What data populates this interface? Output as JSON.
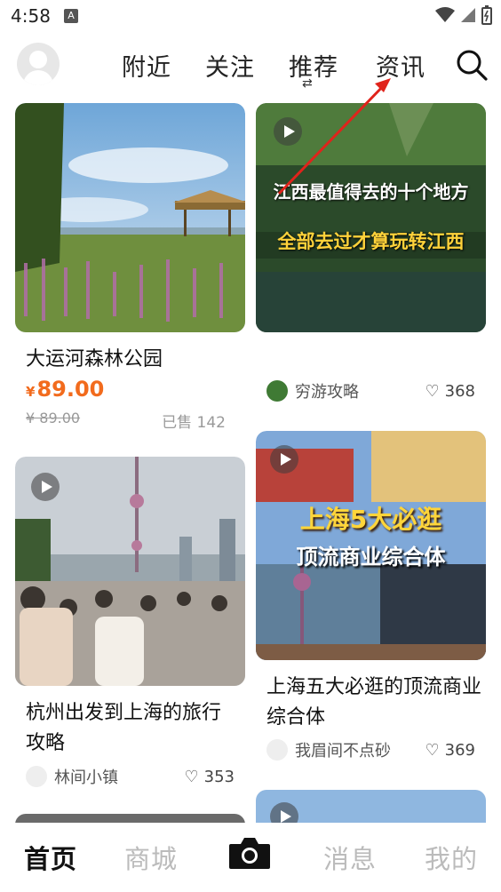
{
  "status": {
    "time": "4:58",
    "notif_letter": "A"
  },
  "topnav": {
    "tabs": [
      "附近",
      "关注",
      "推荐",
      "资讯"
    ],
    "active_index": 2
  },
  "cards": {
    "c1": {
      "title": "大运河森林公园",
      "currency": "¥",
      "price": "89.00",
      "old_price": "¥ 89.00",
      "sold": "已售 142"
    },
    "c2": {
      "overlay1": "江西最值得去的十个地方",
      "overlay2": "全部去过才算玩转江西",
      "author": "穷游攻略",
      "likes": "368"
    },
    "c3": {
      "title": "杭州出发到上海的旅行攻略",
      "author": "林间小镇",
      "likes": "353"
    },
    "c4": {
      "overlay1": "上海5大必逛",
      "overlay2": "顶流商业综合体",
      "title": "上海五大必逛的顶流商业综合体",
      "author": "我眉间不点砂",
      "likes": "369"
    }
  },
  "bottomnav": {
    "home": "首页",
    "mall": "商城",
    "messages": "消息",
    "me": "我的"
  },
  "colors": {
    "accent_price": "#f26b1d",
    "active_tab": "#111111",
    "inactive_tab": "#bbbbbb"
  }
}
